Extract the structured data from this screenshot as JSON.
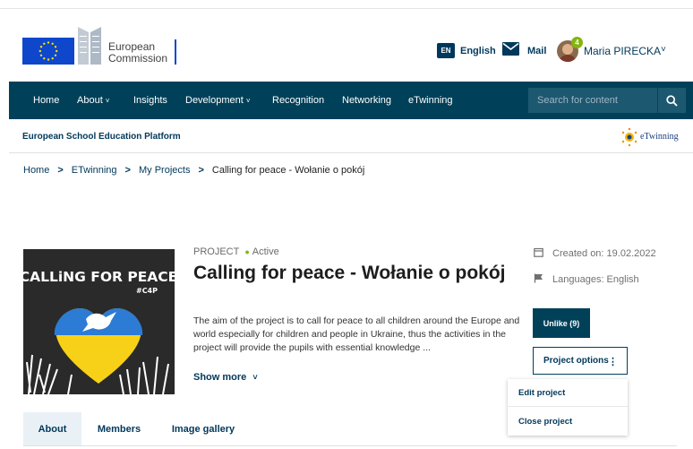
{
  "header": {
    "logo_line1": "European",
    "logo_line2": "Commission",
    "language_code": "EN",
    "language_label": "English",
    "mail_label": "Mail",
    "notification_count": "4",
    "user_name": "Maria PIRECKA",
    "user_caret": "⌄"
  },
  "nav": {
    "items": [
      {
        "label": "Home"
      },
      {
        "label": "About"
      },
      {
        "label": "Insights"
      },
      {
        "label": "Development"
      },
      {
        "label": "Recognition"
      },
      {
        "label": "Networking"
      },
      {
        "label": "eTwinning"
      }
    ],
    "search_placeholder": "Search for content"
  },
  "platform": {
    "title": "European School Education Platform",
    "etwinning_logo": "eTwinning"
  },
  "breadcrumb": {
    "items": [
      "Home",
      "ETwinning",
      "My Projects",
      "Calling for peace - Wołanie o pokój"
    ],
    "separator": ">"
  },
  "project": {
    "type_label": "PROJECT",
    "status": "Active",
    "title": "Calling for peace - Wołanie o pokój",
    "description": "The aim of the project is to call for peace to all children around the Europe and world especially for children and people in Ukraine, thus the activities in the project will provide the pupils with essential knowledge ...",
    "show_more": "Show more",
    "image_text_line1": "CALLiNG FOR PEACE",
    "image_text_line2": "#C4P",
    "created": "Created on: 19.02.2022",
    "languages": "Languages: English"
  },
  "actions": {
    "unlike_label": "Unlike (9)",
    "options_label": "Project options",
    "menu": [
      "Edit project",
      "Close project"
    ]
  },
  "tabs": [
    "About",
    "Members",
    "Image gallery"
  ],
  "colors": {
    "primary": "#004159",
    "accent_green": "#84b50f",
    "ec_blue": "#0e47cb"
  }
}
